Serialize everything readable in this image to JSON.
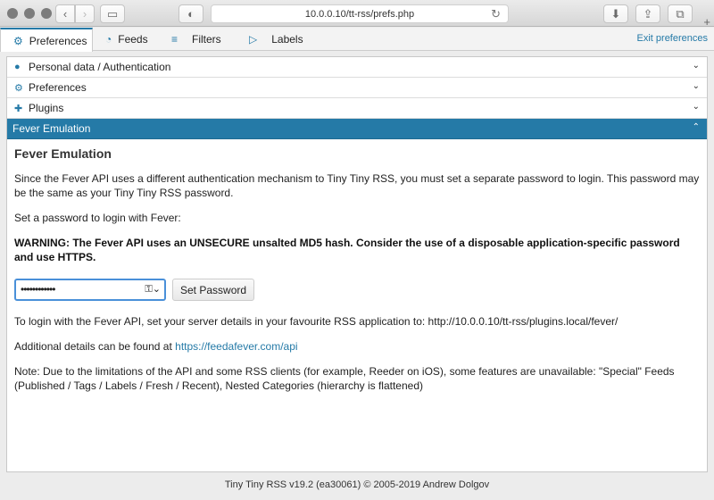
{
  "browser": {
    "url": "10.0.0.10/tt-rss/prefs.php"
  },
  "tabs": [
    {
      "label": "Preferences",
      "icon": "gear-icon",
      "active": true
    },
    {
      "label": "Feeds",
      "icon": "rss-icon"
    },
    {
      "label": "Filters",
      "icon": "filter-icon"
    },
    {
      "label": "Labels",
      "icon": "label-icon"
    }
  ],
  "exit_label": "Exit preferences",
  "accordion": [
    {
      "label": "Personal data / Authentication",
      "icon": "user-icon"
    },
    {
      "label": "Preferences",
      "icon": "gear-icon"
    },
    {
      "label": "Plugins",
      "icon": "puzzle-icon"
    },
    {
      "label": "Fever Emulation",
      "active": true
    }
  ],
  "fever": {
    "heading": "Fever Emulation",
    "intro": "Since the Fever API uses a different authentication mechanism to Tiny Tiny RSS, you must set a separate password to login. This password may be the same as your Tiny Tiny RSS password.",
    "set_password_prompt": "Set a password to login with Fever:",
    "warning": "WARNING: The Fever API uses an UNSECURE unsalted MD5 hash. Consider the use of a disposable application-specific password and use HTTPS.",
    "password_masked": "••••••••••••",
    "set_button": "Set Password",
    "login_info": "To login with the Fever API, set your server details in your favourite RSS application to: http://10.0.0.10/tt-rss/plugins.local/fever/",
    "details_prefix": "Additional details can be found at ",
    "details_link": "https://feedafever.com/api",
    "note": "Note: Due to the limitations of the API and some RSS clients (for example, Reeder on iOS), some features are unavailable: \"Special\" Feeds (Published / Tags / Labels / Fresh / Recent), Nested Categories (hierarchy is flattened)"
  },
  "footer": "Tiny Tiny RSS v19.2 (ea30061) © 2005-2019 Andrew Dolgov",
  "colors": {
    "accent": "#257aa7",
    "focus": "#4a90d9"
  }
}
